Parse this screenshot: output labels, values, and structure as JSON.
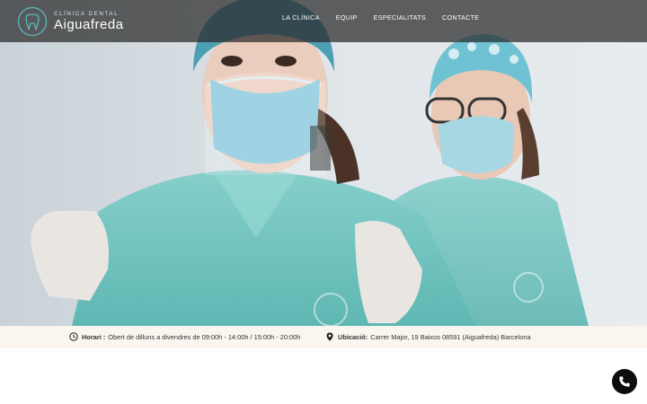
{
  "brand": {
    "subtitle": "CLÍNICA DENTAL",
    "name": "Aiguafreda",
    "logo_icon": "tooth-logo-icon"
  },
  "nav": {
    "items": [
      {
        "label": "LA CLÍNICA"
      },
      {
        "label": "EQUIP"
      },
      {
        "label": "ESPECIALITATS"
      },
      {
        "label": "CONTACTE"
      }
    ]
  },
  "hero": {
    "image": "two dental staff in teal scrubs, surgical caps, masks and gloves"
  },
  "infobar": {
    "hours_label": "Horari :",
    "hours_value": "Obert de dilluns a divendres de 09:00h - 14:00h / 15:00h - 20:00h",
    "hours_icon": "clock-icon",
    "location_label": "Ubicació:",
    "location_value": "Carrer Major, 19 Baixos 08591 (Aiguafreda) Barcelona",
    "location_icon": "map-pin-icon"
  },
  "call_button": {
    "icon": "phone-icon"
  },
  "colors": {
    "accent": "#5bb8c4",
    "header_bg": "#3a3a3a",
    "infobar_bg": "#fbf5ef",
    "scrubs": "#7fc9c6",
    "call_bg": "#0d0d0d"
  }
}
